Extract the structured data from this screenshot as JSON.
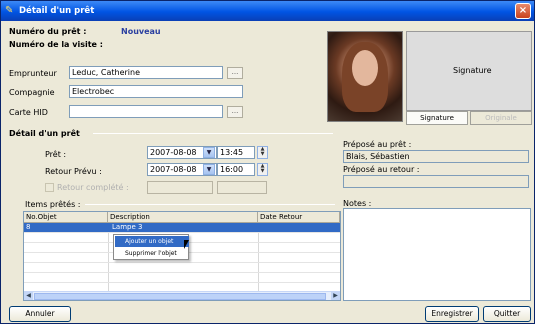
{
  "window": {
    "title": "Détail d'un prêt",
    "close": "×"
  },
  "header": {
    "loan_number_label": "Numéro du prêt :",
    "loan_number_value": "Nouveau",
    "visit_number_label": "Numéro de la visite :"
  },
  "borrower": {
    "emprunteur_label": "Emprunteur",
    "emprunteur_value": "Leduc, Catherine",
    "compagnie_label": "Compagnie",
    "compagnie_value": "Electrobec",
    "carte_label": "Carte HID",
    "carte_value": "",
    "browse_label": "..."
  },
  "signature": {
    "box_label": "Signature",
    "tab_signature": "Signature",
    "tab_originale": "Originale"
  },
  "loan_detail": {
    "section_title": "Détail d'un prêt",
    "pret_label": "Prêt :",
    "pret_date": "2007-08-08",
    "pret_time": "13:45",
    "retour_label": "Retour Prévu :",
    "retour_date": "2007-08-08",
    "retour_time": "16:00",
    "retour_complete_label": "Retour complété :"
  },
  "staff": {
    "prepose_pret_label": "Préposé au prêt :",
    "prepose_pret_value": "Blais, Sébastien",
    "prepose_retour_label": "Préposé au retour :",
    "prepose_retour_value": ""
  },
  "items": {
    "section_label": "Items prêtés :",
    "columns": [
      "No.Objet",
      "Description",
      "Date Retour"
    ],
    "rows": [
      {
        "no": "8",
        "description": "Lampe 3",
        "date": ""
      }
    ]
  },
  "context_menu": {
    "add": "Ajouter un objet",
    "remove": "Supprimer l'objet"
  },
  "notes": {
    "label": "Notes :"
  },
  "buttons": {
    "annuler": "Annuler",
    "enregistrer": "Enregistrer",
    "quitter": "Quitter"
  }
}
